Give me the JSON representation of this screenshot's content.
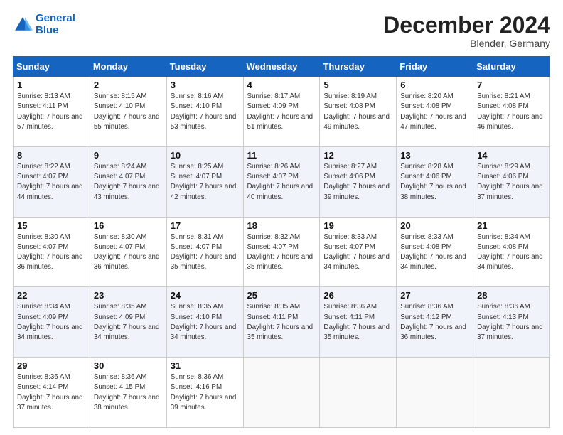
{
  "header": {
    "logo_line1": "General",
    "logo_line2": "Blue",
    "month_title": "December 2024",
    "subtitle": "Blender, Germany"
  },
  "weekdays": [
    "Sunday",
    "Monday",
    "Tuesday",
    "Wednesday",
    "Thursday",
    "Friday",
    "Saturday"
  ],
  "weeks": [
    [
      {
        "day": "1",
        "sunrise": "8:13 AM",
        "sunset": "4:11 PM",
        "daylight": "7 hours and 57 minutes."
      },
      {
        "day": "2",
        "sunrise": "8:15 AM",
        "sunset": "4:10 PM",
        "daylight": "7 hours and 55 minutes."
      },
      {
        "day": "3",
        "sunrise": "8:16 AM",
        "sunset": "4:10 PM",
        "daylight": "7 hours and 53 minutes."
      },
      {
        "day": "4",
        "sunrise": "8:17 AM",
        "sunset": "4:09 PM",
        "daylight": "7 hours and 51 minutes."
      },
      {
        "day": "5",
        "sunrise": "8:19 AM",
        "sunset": "4:08 PM",
        "daylight": "7 hours and 49 minutes."
      },
      {
        "day": "6",
        "sunrise": "8:20 AM",
        "sunset": "4:08 PM",
        "daylight": "7 hours and 47 minutes."
      },
      {
        "day": "7",
        "sunrise": "8:21 AM",
        "sunset": "4:08 PM",
        "daylight": "7 hours and 46 minutes."
      }
    ],
    [
      {
        "day": "8",
        "sunrise": "8:22 AM",
        "sunset": "4:07 PM",
        "daylight": "7 hours and 44 minutes."
      },
      {
        "day": "9",
        "sunrise": "8:24 AM",
        "sunset": "4:07 PM",
        "daylight": "7 hours and 43 minutes."
      },
      {
        "day": "10",
        "sunrise": "8:25 AM",
        "sunset": "4:07 PM",
        "daylight": "7 hours and 42 minutes."
      },
      {
        "day": "11",
        "sunrise": "8:26 AM",
        "sunset": "4:07 PM",
        "daylight": "7 hours and 40 minutes."
      },
      {
        "day": "12",
        "sunrise": "8:27 AM",
        "sunset": "4:06 PM",
        "daylight": "7 hours and 39 minutes."
      },
      {
        "day": "13",
        "sunrise": "8:28 AM",
        "sunset": "4:06 PM",
        "daylight": "7 hours and 38 minutes."
      },
      {
        "day": "14",
        "sunrise": "8:29 AM",
        "sunset": "4:06 PM",
        "daylight": "7 hours and 37 minutes."
      }
    ],
    [
      {
        "day": "15",
        "sunrise": "8:30 AM",
        "sunset": "4:07 PM",
        "daylight": "7 hours and 36 minutes."
      },
      {
        "day": "16",
        "sunrise": "8:30 AM",
        "sunset": "4:07 PM",
        "daylight": "7 hours and 36 minutes."
      },
      {
        "day": "17",
        "sunrise": "8:31 AM",
        "sunset": "4:07 PM",
        "daylight": "7 hours and 35 minutes."
      },
      {
        "day": "18",
        "sunrise": "8:32 AM",
        "sunset": "4:07 PM",
        "daylight": "7 hours and 35 minutes."
      },
      {
        "day": "19",
        "sunrise": "8:33 AM",
        "sunset": "4:07 PM",
        "daylight": "7 hours and 34 minutes."
      },
      {
        "day": "20",
        "sunrise": "8:33 AM",
        "sunset": "4:08 PM",
        "daylight": "7 hours and 34 minutes."
      },
      {
        "day": "21",
        "sunrise": "8:34 AM",
        "sunset": "4:08 PM",
        "daylight": "7 hours and 34 minutes."
      }
    ],
    [
      {
        "day": "22",
        "sunrise": "8:34 AM",
        "sunset": "4:09 PM",
        "daylight": "7 hours and 34 minutes."
      },
      {
        "day": "23",
        "sunrise": "8:35 AM",
        "sunset": "4:09 PM",
        "daylight": "7 hours and 34 minutes."
      },
      {
        "day": "24",
        "sunrise": "8:35 AM",
        "sunset": "4:10 PM",
        "daylight": "7 hours and 34 minutes."
      },
      {
        "day": "25",
        "sunrise": "8:35 AM",
        "sunset": "4:11 PM",
        "daylight": "7 hours and 35 minutes."
      },
      {
        "day": "26",
        "sunrise": "8:36 AM",
        "sunset": "4:11 PM",
        "daylight": "7 hours and 35 minutes."
      },
      {
        "day": "27",
        "sunrise": "8:36 AM",
        "sunset": "4:12 PM",
        "daylight": "7 hours and 36 minutes."
      },
      {
        "day": "28",
        "sunrise": "8:36 AM",
        "sunset": "4:13 PM",
        "daylight": "7 hours and 37 minutes."
      }
    ],
    [
      {
        "day": "29",
        "sunrise": "8:36 AM",
        "sunset": "4:14 PM",
        "daylight": "7 hours and 37 minutes."
      },
      {
        "day": "30",
        "sunrise": "8:36 AM",
        "sunset": "4:15 PM",
        "daylight": "7 hours and 38 minutes."
      },
      {
        "day": "31",
        "sunrise": "8:36 AM",
        "sunset": "4:16 PM",
        "daylight": "7 hours and 39 minutes."
      },
      null,
      null,
      null,
      null
    ]
  ]
}
